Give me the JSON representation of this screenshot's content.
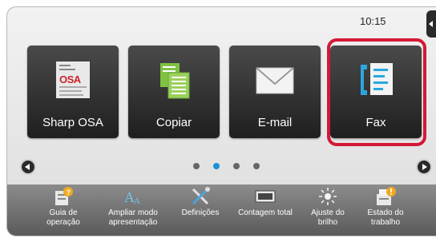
{
  "status": {
    "time": "10:15"
  },
  "apps": [
    {
      "label": "Sharp OSA",
      "icon": "sharp-osa-icon"
    },
    {
      "label": "Copiar",
      "icon": "copy-icon"
    },
    {
      "label": "E-mail",
      "icon": "envelope-icon"
    },
    {
      "label": "Fax",
      "icon": "fax-icon"
    }
  ],
  "pager": {
    "pages": 4,
    "active": 2
  },
  "bottom": [
    {
      "label": "Guia de operação",
      "icon": "guide-help-icon"
    },
    {
      "label": "Ampliar modo apresentação",
      "icon": "font-enlarge-icon"
    },
    {
      "label": "Definições",
      "icon": "tools-settings-icon"
    },
    {
      "label": "Contagem total",
      "icon": "counter-icon"
    },
    {
      "label": "Ajuste do brilho",
      "icon": "brightness-icon"
    },
    {
      "label": "Estado do trabalho",
      "icon": "job-status-icon"
    }
  ],
  "colors": {
    "highlight": "#d31935",
    "accent": "#1f8fd6",
    "tile": "#2b2b2b"
  }
}
